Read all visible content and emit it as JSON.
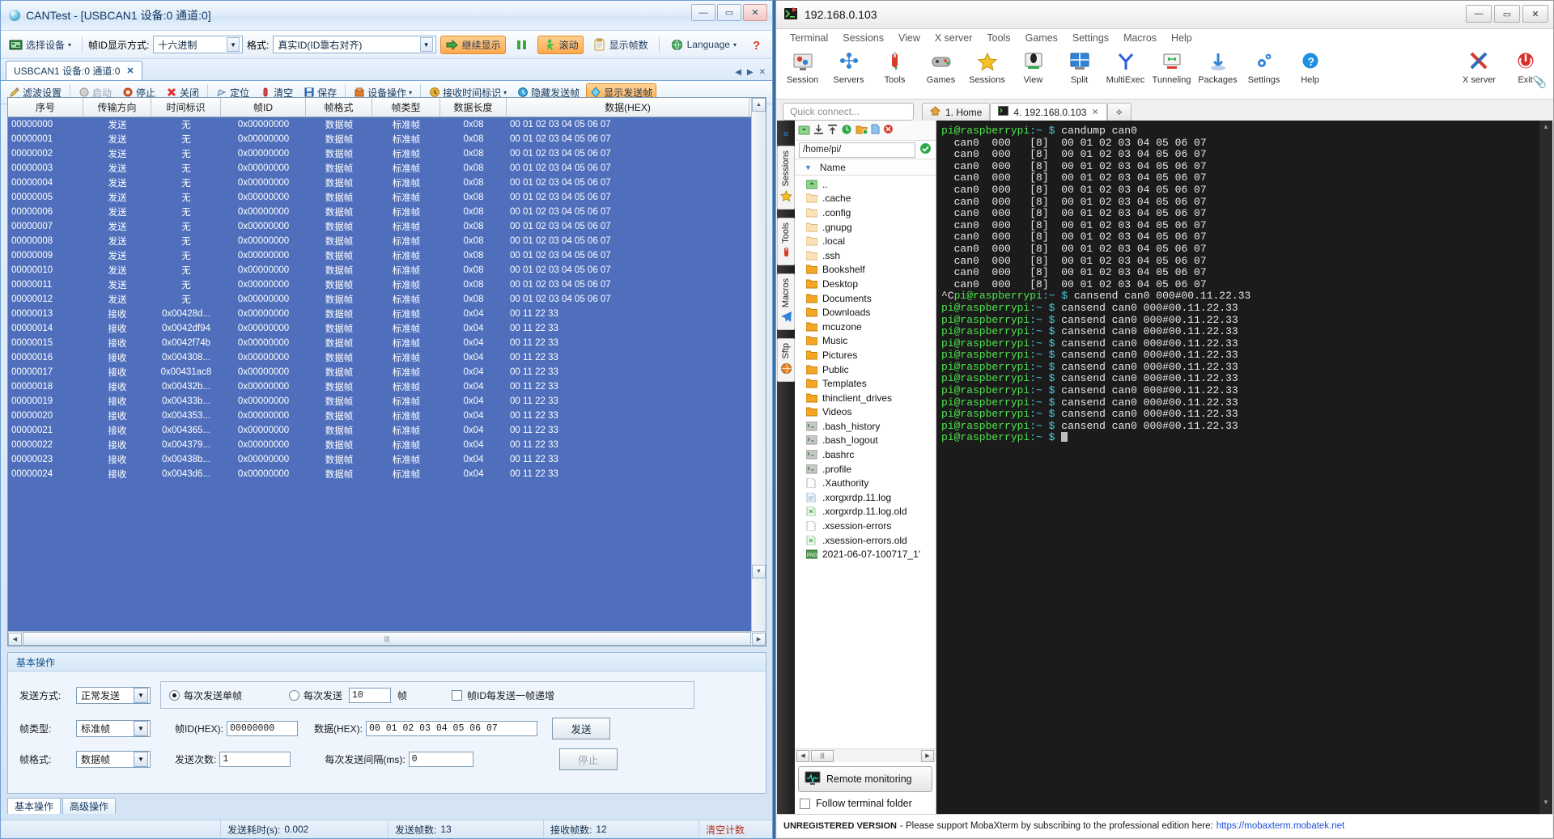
{
  "cantest": {
    "title": "CANTest - [USBCAN1 设备:0 通道:0]",
    "window_buttons": {
      "minimize": "—",
      "maximize": "▭",
      "close": "✕"
    },
    "toolbar": {
      "select_device": "选择设备",
      "frameid_mode_label": "帧ID显示方式:",
      "frameid_mode_value": "十六进制",
      "format_label": "格式:",
      "format_value": "真实ID(ID靠右对齐)",
      "continue_display": "继续显示",
      "pause": "",
      "scroll": "滚动",
      "show_frame_count": "显示帧数",
      "language": "Language",
      "help": "?"
    },
    "tab": {
      "label": "USBCAN1 设备:0 通道:0",
      "close": "✕"
    },
    "tab_nav": {
      "prev": "◀",
      "next": "▶",
      "close_all": "✕"
    },
    "toolbar2": {
      "filter": "滤波设置",
      "start": "启动",
      "stop": "停止",
      "close": "关闭",
      "locate": "定位",
      "clear": "清空",
      "save": "保存",
      "device_op": "设备操作",
      "recv_time_flag": "接收时间标识",
      "hide_send_frame": "隐藏发送帧",
      "show_send_frame": "显示发送帧"
    },
    "grid": {
      "headers": [
        "序号",
        "传输方向",
        "时间标识",
        "帧ID",
        "帧格式",
        "帧类型",
        "数据长度",
        "数据(HEX)"
      ],
      "rows": [
        [
          "00000000",
          "发送",
          "无",
          "0x00000000",
          "数据帧",
          "标准帧",
          "0x08",
          "00 01 02 03 04 05 06 07"
        ],
        [
          "00000001",
          "发送",
          "无",
          "0x00000000",
          "数据帧",
          "标准帧",
          "0x08",
          "00 01 02 03 04 05 06 07"
        ],
        [
          "00000002",
          "发送",
          "无",
          "0x00000000",
          "数据帧",
          "标准帧",
          "0x08",
          "00 01 02 03 04 05 06 07"
        ],
        [
          "00000003",
          "发送",
          "无",
          "0x00000000",
          "数据帧",
          "标准帧",
          "0x08",
          "00 01 02 03 04 05 06 07"
        ],
        [
          "00000004",
          "发送",
          "无",
          "0x00000000",
          "数据帧",
          "标准帧",
          "0x08",
          "00 01 02 03 04 05 06 07"
        ],
        [
          "00000005",
          "发送",
          "无",
          "0x00000000",
          "数据帧",
          "标准帧",
          "0x08",
          "00 01 02 03 04 05 06 07"
        ],
        [
          "00000006",
          "发送",
          "无",
          "0x00000000",
          "数据帧",
          "标准帧",
          "0x08",
          "00 01 02 03 04 05 06 07"
        ],
        [
          "00000007",
          "发送",
          "无",
          "0x00000000",
          "数据帧",
          "标准帧",
          "0x08",
          "00 01 02 03 04 05 06 07"
        ],
        [
          "00000008",
          "发送",
          "无",
          "0x00000000",
          "数据帧",
          "标准帧",
          "0x08",
          "00 01 02 03 04 05 06 07"
        ],
        [
          "00000009",
          "发送",
          "无",
          "0x00000000",
          "数据帧",
          "标准帧",
          "0x08",
          "00 01 02 03 04 05 06 07"
        ],
        [
          "00000010",
          "发送",
          "无",
          "0x00000000",
          "数据帧",
          "标准帧",
          "0x08",
          "00 01 02 03 04 05 06 07"
        ],
        [
          "00000011",
          "发送",
          "无",
          "0x00000000",
          "数据帧",
          "标准帧",
          "0x08",
          "00 01 02 03 04 05 06 07"
        ],
        [
          "00000012",
          "发送",
          "无",
          "0x00000000",
          "数据帧",
          "标准帧",
          "0x08",
          "00 01 02 03 04 05 06 07"
        ],
        [
          "00000013",
          "接收",
          "0x00428d...",
          "0x00000000",
          "数据帧",
          "标准帧",
          "0x04",
          "00 11 22 33"
        ],
        [
          "00000014",
          "接收",
          "0x0042df94",
          "0x00000000",
          "数据帧",
          "标准帧",
          "0x04",
          "00 11 22 33"
        ],
        [
          "00000015",
          "接收",
          "0x0042f74b",
          "0x00000000",
          "数据帧",
          "标准帧",
          "0x04",
          "00 11 22 33"
        ],
        [
          "00000016",
          "接收",
          "0x004308...",
          "0x00000000",
          "数据帧",
          "标准帧",
          "0x04",
          "00 11 22 33"
        ],
        [
          "00000017",
          "接收",
          "0x00431ac8",
          "0x00000000",
          "数据帧",
          "标准帧",
          "0x04",
          "00 11 22 33"
        ],
        [
          "00000018",
          "接收",
          "0x00432b...",
          "0x00000000",
          "数据帧",
          "标准帧",
          "0x04",
          "00 11 22 33"
        ],
        [
          "00000019",
          "接收",
          "0x00433b...",
          "0x00000000",
          "数据帧",
          "标准帧",
          "0x04",
          "00 11 22 33"
        ],
        [
          "00000020",
          "接收",
          "0x004353...",
          "0x00000000",
          "数据帧",
          "标准帧",
          "0x04",
          "00 11 22 33"
        ],
        [
          "00000021",
          "接收",
          "0x004365...",
          "0x00000000",
          "数据帧",
          "标准帧",
          "0x04",
          "00 11 22 33"
        ],
        [
          "00000022",
          "接收",
          "0x004379...",
          "0x00000000",
          "数据帧",
          "标准帧",
          "0x04",
          "00 11 22 33"
        ],
        [
          "00000023",
          "接收",
          "0x00438b...",
          "0x00000000",
          "数据帧",
          "标准帧",
          "0x04",
          "00 11 22 33"
        ],
        [
          "00000024",
          "接收",
          "0x0043d6...",
          "0x00000000",
          "数据帧",
          "标准帧",
          "0x04",
          "00 11 22 33"
        ]
      ]
    },
    "ops": {
      "title": "基本操作",
      "send_mode_label": "发送方式:",
      "send_mode_value": "正常发送",
      "frame_type_label": "帧类型:",
      "frame_type_value": "标准帧",
      "frame_format_label": "帧格式:",
      "frame_format_value": "数据帧",
      "radio_single": "每次发送单帧",
      "radio_multi": "每次发送",
      "multi_count": "10",
      "frames_unit": "帧",
      "checkbox_increment": "帧ID每发送一帧递增",
      "frameid_label": "帧ID(HEX):",
      "frameid_value": "00000000",
      "data_label": "数据(HEX):",
      "data_value": "00 01 02 03 04 05 06 07",
      "send_button": "发送",
      "send_count_label": "发送次数:",
      "send_count_value": "1",
      "interval_label": "每次发送间隔(ms):",
      "interval_value": "0",
      "stop_button": "停止"
    },
    "bottom_tabs": [
      {
        "label": "基本操作",
        "active": true
      },
      {
        "label": "高级操作",
        "active": false
      }
    ],
    "status": {
      "send_time_label": "发送耗时(s):",
      "send_time_value": "0.002",
      "send_frames_label": "发送帧数:",
      "send_frames_value": "13",
      "recv_frames_label": "接收帧数:",
      "recv_frames_value": "12",
      "clear_counter": "清空计数"
    }
  },
  "moba": {
    "title": "192.168.0.103",
    "window_buttons": {
      "minimize": "—",
      "maximize": "▭",
      "close": "✕"
    },
    "menu": [
      "Terminal",
      "Sessions",
      "View",
      "X server",
      "Tools",
      "Games",
      "Settings",
      "Macros",
      "Help"
    ],
    "ribbon": [
      {
        "label": "Session",
        "icon": "session-icon"
      },
      {
        "label": "Servers",
        "icon": "servers-icon"
      },
      {
        "label": "Tools",
        "icon": "tools-icon"
      },
      {
        "label": "Games",
        "icon": "games-icon"
      },
      {
        "label": "Sessions",
        "icon": "sessions-star-icon"
      },
      {
        "label": "View",
        "icon": "view-icon"
      },
      {
        "label": "Split",
        "icon": "split-icon"
      },
      {
        "label": "MultiExec",
        "icon": "multiexec-icon"
      },
      {
        "label": "Tunneling",
        "icon": "tunneling-icon"
      },
      {
        "label": "Packages",
        "icon": "packages-icon"
      },
      {
        "label": "Settings",
        "icon": "settings-gear-icon"
      },
      {
        "label": "Help",
        "icon": "help-icon"
      }
    ],
    "ribbon_right": [
      {
        "label": "X server",
        "icon": "xserver-icon"
      },
      {
        "label": "Exit",
        "icon": "exit-power-icon"
      }
    ],
    "quick_connect_placeholder": "Quick connect...",
    "tabs": [
      {
        "label": "1. Home",
        "active": false,
        "icon": "home-icon"
      },
      {
        "label": "4. 192.168.0.103",
        "active": true,
        "icon": "terminal-tab-icon",
        "close": "✕"
      }
    ],
    "tab_add": "✧",
    "sidebar": {
      "rail_collapse": "«",
      "rail_groups": [
        "Sessions",
        "Tools",
        "Macros",
        "Sftp"
      ],
      "path": "/home/pi/",
      "name_header": "Name",
      "files": [
        {
          "name": "..",
          "type": "up"
        },
        {
          "name": ".cache",
          "type": "folder-dim"
        },
        {
          "name": ".config",
          "type": "folder-dim"
        },
        {
          "name": ".gnupg",
          "type": "folder-dim"
        },
        {
          "name": ".local",
          "type": "folder-dim"
        },
        {
          "name": ".ssh",
          "type": "folder-dim"
        },
        {
          "name": "Bookshelf",
          "type": "folder"
        },
        {
          "name": "Desktop",
          "type": "folder"
        },
        {
          "name": "Documents",
          "type": "folder"
        },
        {
          "name": "Downloads",
          "type": "folder"
        },
        {
          "name": "mcuzone",
          "type": "folder"
        },
        {
          "name": "Music",
          "type": "folder"
        },
        {
          "name": "Pictures",
          "type": "folder"
        },
        {
          "name": "Public",
          "type": "folder"
        },
        {
          "name": "Templates",
          "type": "folder"
        },
        {
          "name": "thinclient_drives",
          "type": "folder"
        },
        {
          "name": "Videos",
          "type": "folder"
        },
        {
          "name": ".bash_history",
          "type": "script"
        },
        {
          "name": ".bash_logout",
          "type": "script"
        },
        {
          "name": ".bashrc",
          "type": "script"
        },
        {
          "name": ".profile",
          "type": "script"
        },
        {
          "name": ".Xauthority",
          "type": "file"
        },
        {
          "name": ".xorgxrdp.11.log",
          "type": "log"
        },
        {
          "name": ".xorgxrdp.11.log.old",
          "type": "old"
        },
        {
          "name": ".xsession-errors",
          "type": "file"
        },
        {
          "name": ".xsession-errors.old",
          "type": "old"
        },
        {
          "name": "2021-06-07-100717_1'",
          "type": "png"
        }
      ],
      "remote_monitoring": "Remote monitoring",
      "follow_terminal_folder": "Follow terminal folder"
    },
    "terminal": {
      "prompt_user": "pi@raspberrypi",
      "prompt_path": ":~",
      "prompt_sym": "$",
      "first_command": "candump can0",
      "dump_line": "  can0  000   [8]  00 01 02 03 04 05 06 07",
      "dump_count": 13,
      "interrupt": "^C",
      "send_command": "cansend can0 000#00.11.22.33",
      "send_count": 12
    },
    "status": {
      "unregistered": "UNREGISTERED VERSION",
      "message": "- Please support MobaXterm by subscribing to the professional edition here:",
      "link": "https://mobaxterm.mobatek.net"
    }
  }
}
